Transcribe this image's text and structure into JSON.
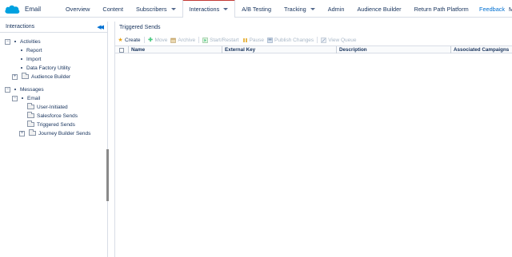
{
  "app": {
    "brand_name": "Email",
    "brand_color": "#00a1e0",
    "logo_icon": "salesforce-cloud-icon"
  },
  "nav": {
    "items": [
      {
        "label": "Overview",
        "dropdown": false,
        "active": false
      },
      {
        "label": "Content",
        "dropdown": false,
        "active": false
      },
      {
        "label": "Subscribers",
        "dropdown": true,
        "active": false
      },
      {
        "label": "Interactions",
        "dropdown": true,
        "active": true
      },
      {
        "label": "A/B Testing",
        "dropdown": false,
        "active": false
      },
      {
        "label": "Tracking",
        "dropdown": true,
        "active": false
      },
      {
        "label": "Admin",
        "dropdown": false,
        "active": false
      },
      {
        "label": "Audience Builder",
        "dropdown": false,
        "active": false
      },
      {
        "label": "Return Path Platform",
        "dropdown": false,
        "active": false
      }
    ],
    "feedback": "Feedback",
    "user_initial": "M",
    "active_color": "#c23934",
    "link_color": "#0070d2"
  },
  "sidebar": {
    "title": "Interactions",
    "collapse_icon": "double-chevron-left-icon",
    "tree": [
      {
        "label": "Activities",
        "toggle": "−",
        "bullet": true
      },
      {
        "label": "Report",
        "bullet": true
      },
      {
        "label": "Import",
        "bullet": true
      },
      {
        "label": "Data Factory Utility",
        "bullet": true
      },
      {
        "label": "Audience Builder",
        "toggle": "+",
        "folder": true
      },
      {
        "label": "Messages",
        "toggle": "−",
        "bullet": true
      },
      {
        "label": "Email",
        "toggle": "−",
        "bullet": true
      },
      {
        "label": "User-Initiated",
        "folder": true
      },
      {
        "label": "Salesforce Sends",
        "folder": true
      },
      {
        "label": "Triggered Sends",
        "folder": true
      },
      {
        "label": "Journey Builder Sends",
        "toggle": "+",
        "folder": true
      }
    ]
  },
  "main": {
    "title": "Triggered Sends",
    "toolbar": [
      {
        "label": "Create",
        "icon": "star-icon",
        "enabled": true
      },
      {
        "label": "Move",
        "icon": "move-icon",
        "enabled": false
      },
      {
        "label": "Archive",
        "icon": "archive-icon",
        "enabled": false
      },
      {
        "label": "Start/Restart",
        "icon": "play-icon",
        "enabled": false
      },
      {
        "label": "Pause",
        "icon": "pause-icon",
        "enabled": false
      },
      {
        "label": "Publish Changes",
        "icon": "publish-icon",
        "enabled": false
      },
      {
        "label": "View Queue",
        "icon": "queue-icon",
        "enabled": false
      }
    ],
    "columns": [
      "Name",
      "External Key",
      "Description",
      "Associated Campaigns"
    ],
    "rows": []
  }
}
